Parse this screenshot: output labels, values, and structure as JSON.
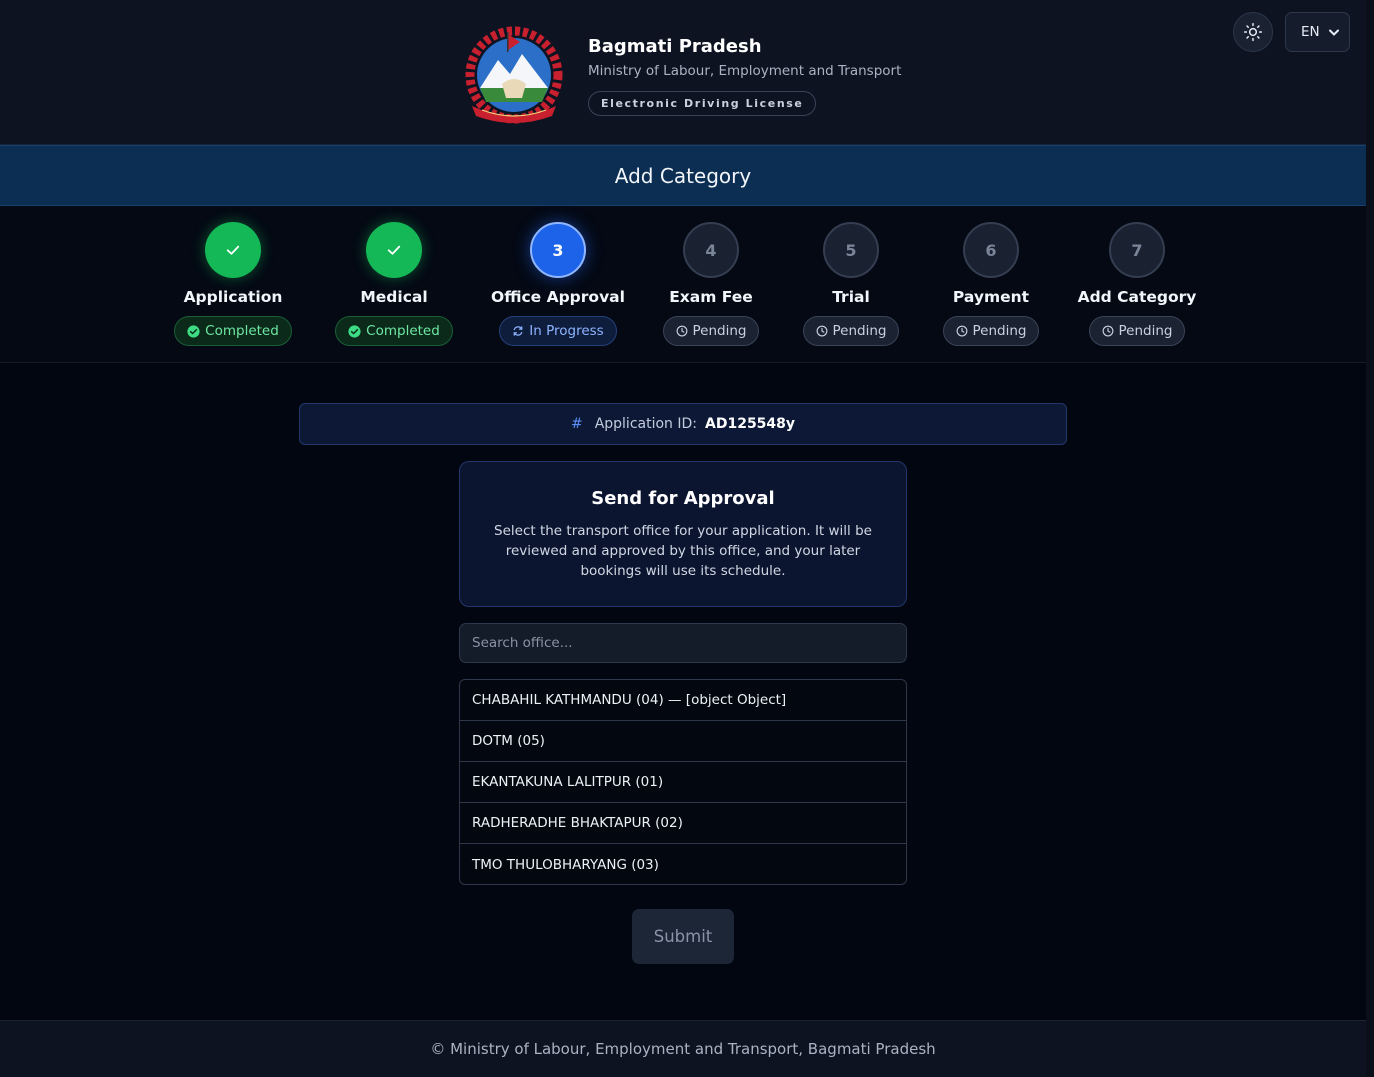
{
  "header": {
    "org_name": "Bagmati Pradesh",
    "ministry": "Ministry of Labour, Employment and Transport",
    "badge": "Electronic Driving License",
    "language": "EN",
    "theme_icon": "sun-icon",
    "emblem_icon": "nepal-emblem-icon"
  },
  "title_bar": {
    "title": "Add Category"
  },
  "steps": [
    {
      "number": "1",
      "label": "Application",
      "status": "Completed",
      "state": "done"
    },
    {
      "number": "2",
      "label": "Medical",
      "status": "Completed",
      "state": "done"
    },
    {
      "number": "3",
      "label": "Office Approval",
      "status": "In Progress",
      "state": "current"
    },
    {
      "number": "4",
      "label": "Exam Fee",
      "status": "Pending",
      "state": "pending"
    },
    {
      "number": "5",
      "label": "Trial",
      "status": "Pending",
      "state": "pending"
    },
    {
      "number": "6",
      "label": "Payment",
      "status": "Pending",
      "state": "pending"
    },
    {
      "number": "7",
      "label": "Add Category",
      "status": "Pending",
      "state": "pending"
    }
  ],
  "application": {
    "hash": "#",
    "label": "Application ID:",
    "id": "AD125548y"
  },
  "approval": {
    "title": "Send for Approval",
    "description": "Select the transport office for your application. It will be reviewed and approved by this office, and your later bookings will use its schedule."
  },
  "search": {
    "placeholder": "Search office...",
    "value": ""
  },
  "offices": [
    "CHABAHIL KATHMANDU (04) — [object Object]",
    "DOTM (05)",
    "EKANTAKUNA LALITPUR (01)",
    "RADHERADHE BHAKTAPUR (02)",
    "TMO THULOBHARYANG (03)"
  ],
  "submit": {
    "label": "Submit"
  },
  "footer": {
    "text": "© Ministry of Labour, Employment and Transport, Bagmati Pradesh"
  },
  "colors": {
    "completed": "#14b856",
    "current": "#1d63ea",
    "pending": "#1a2232",
    "title_bar": "#0b2e52"
  }
}
